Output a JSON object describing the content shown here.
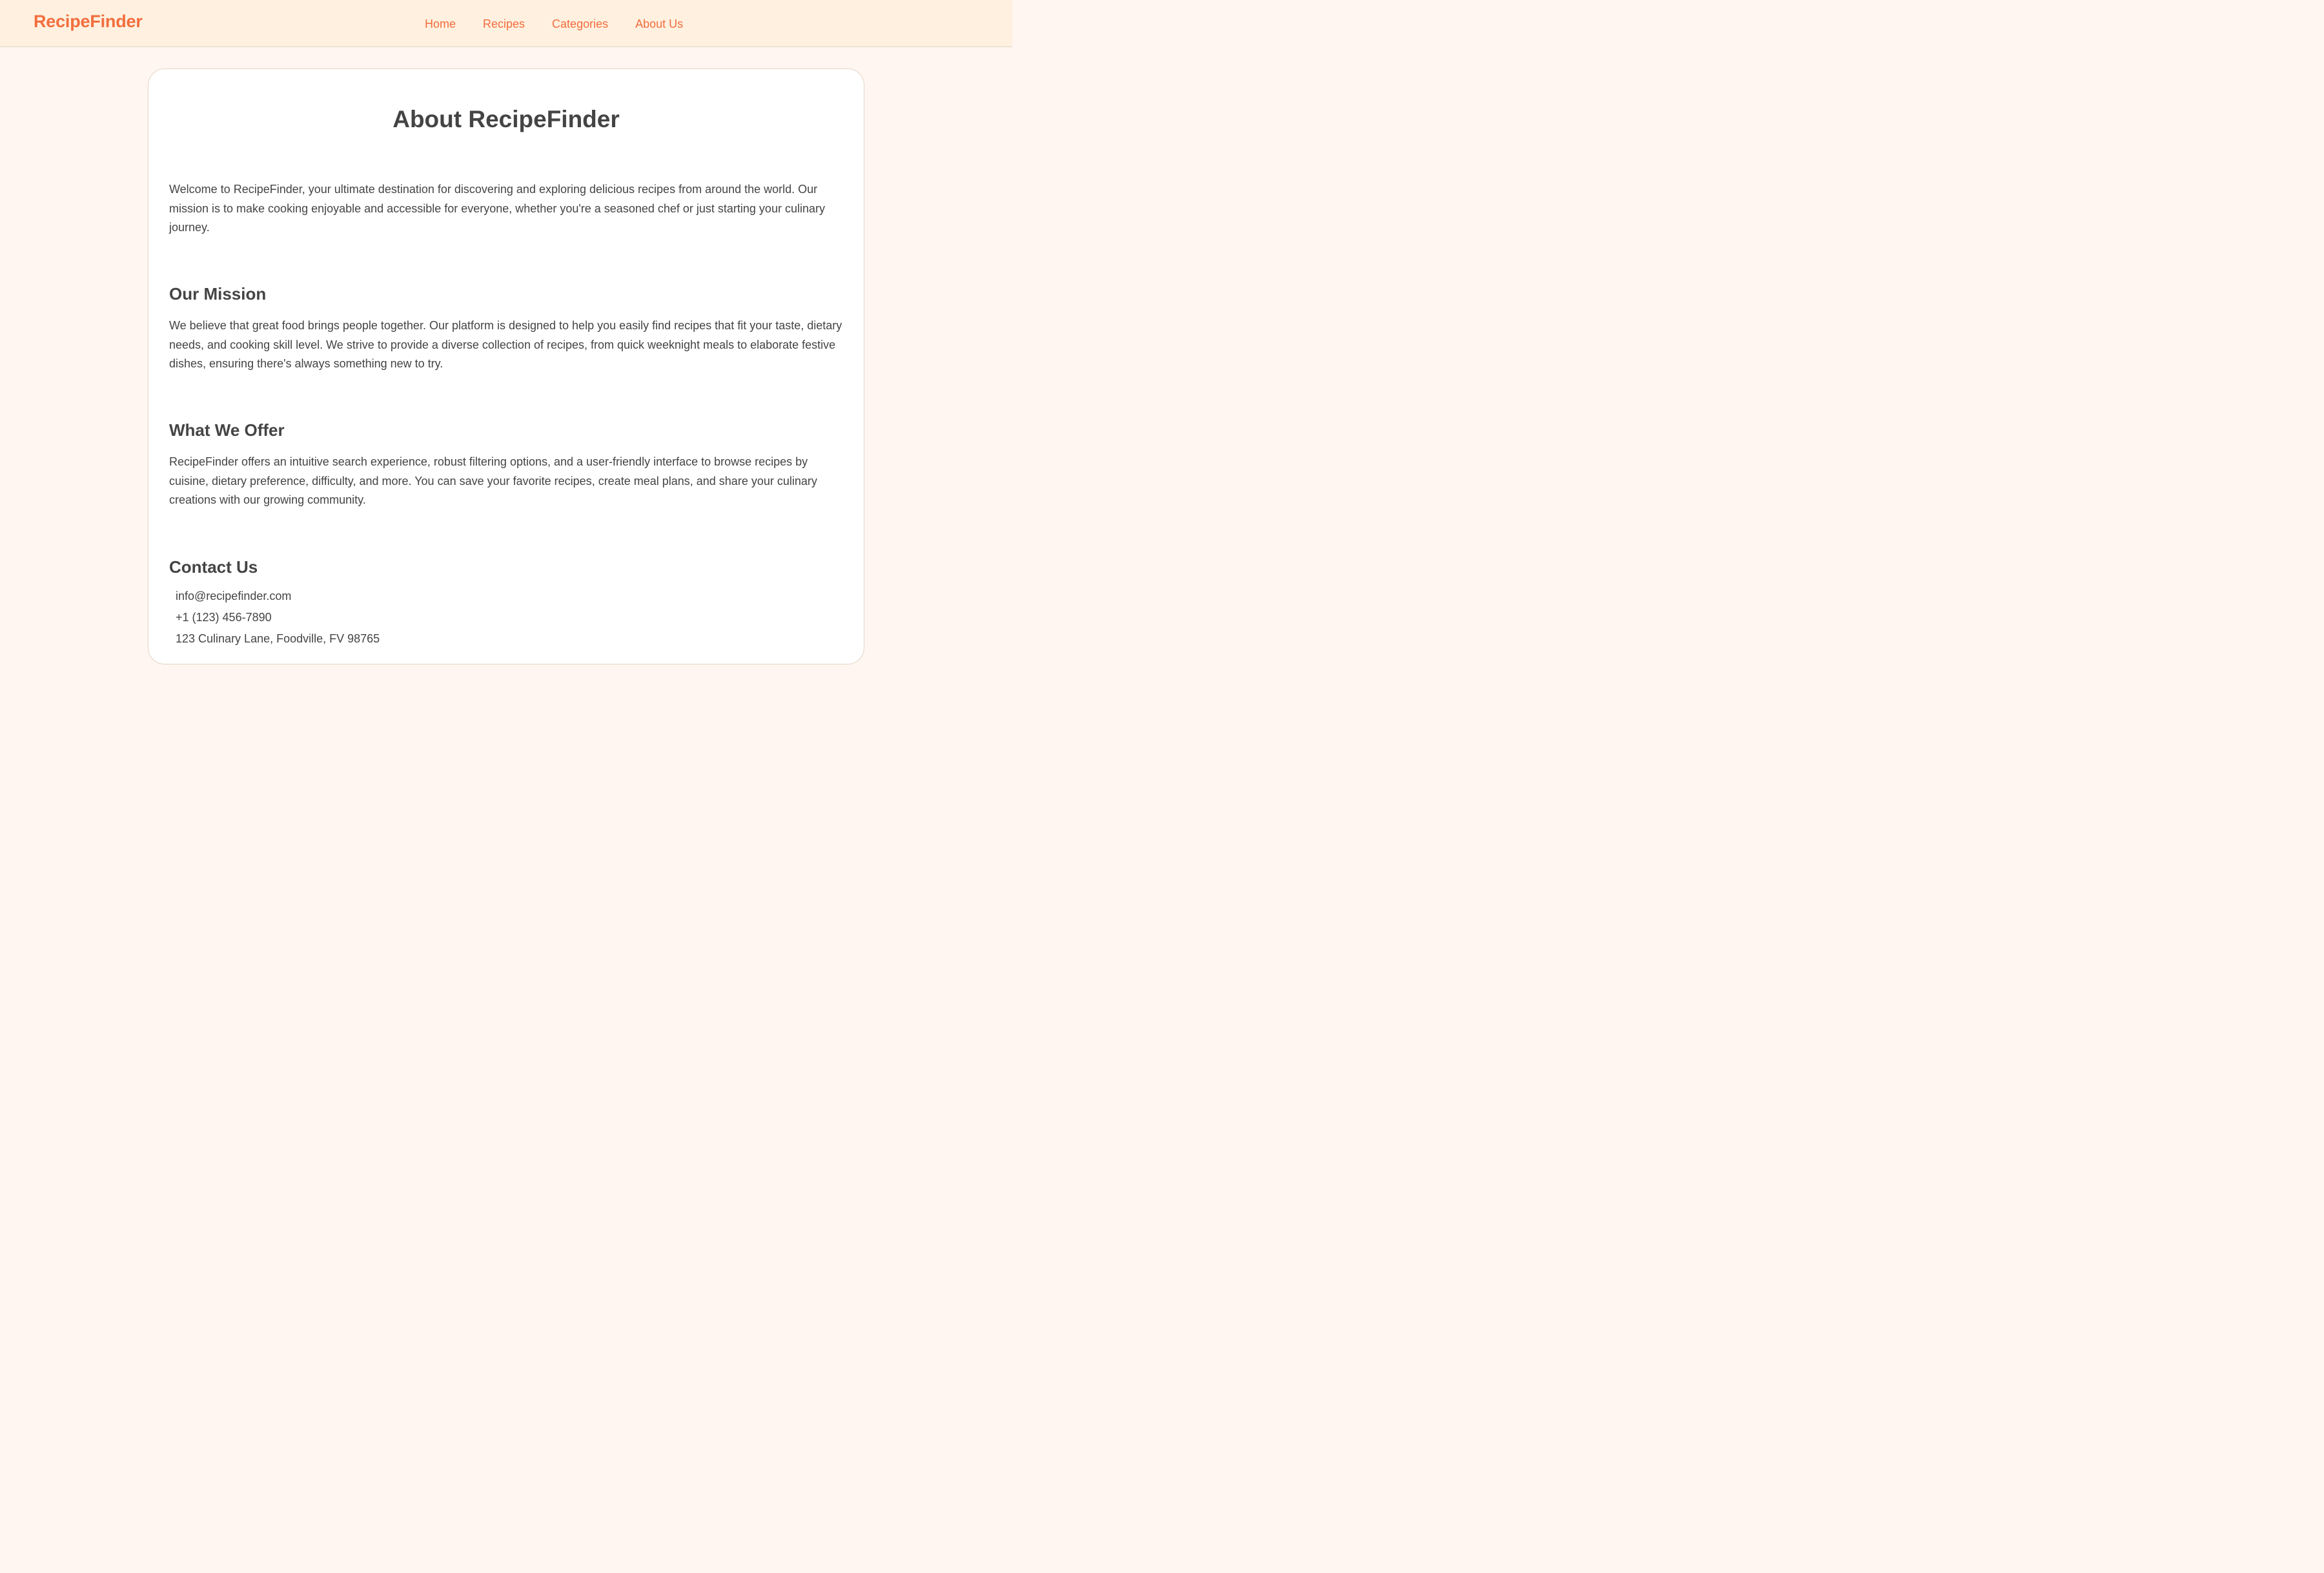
{
  "header": {
    "brand": "RecipeFinder",
    "nav": [
      "Home",
      "Recipes",
      "Categories",
      "About Us"
    ]
  },
  "main": {
    "title": "About RecipeFinder",
    "intro": "Welcome to RecipeFinder, your ultimate destination for discovering and exploring delicious recipes from around the world. Our mission is to make cooking enjoyable and accessible for everyone, whether you're a seasoned chef or just starting your culinary journey.",
    "sections": [
      {
        "heading": "Our Mission",
        "text": "We believe that great food brings people together. Our platform is designed to help you easily find recipes that fit your taste, dietary needs, and cooking skill level. We strive to provide a diverse collection of recipes, from quick weeknight meals to elaborate festive dishes, ensuring there's always something new to try."
      },
      {
        "heading": "What We Offer",
        "text": "RecipeFinder offers an intuitive search experience, robust filtering options, and a user-friendly interface to browse recipes by cuisine, dietary preference, difficulty, and more. You can save your favorite recipes, create meal plans, and share your culinary creations with our growing community."
      }
    ],
    "contact": {
      "heading": "Contact Us",
      "email": "info@recipefinder.com",
      "phone": "+1 (123) 456-7890",
      "address": "123 Culinary Lane, Foodville, FV 98765"
    }
  },
  "colors": {
    "accent": "#f26d3d",
    "header_bg": "#fff0df",
    "page_bg": "#fff6f1",
    "card_bg": "#ffffff",
    "text": "#444444"
  }
}
